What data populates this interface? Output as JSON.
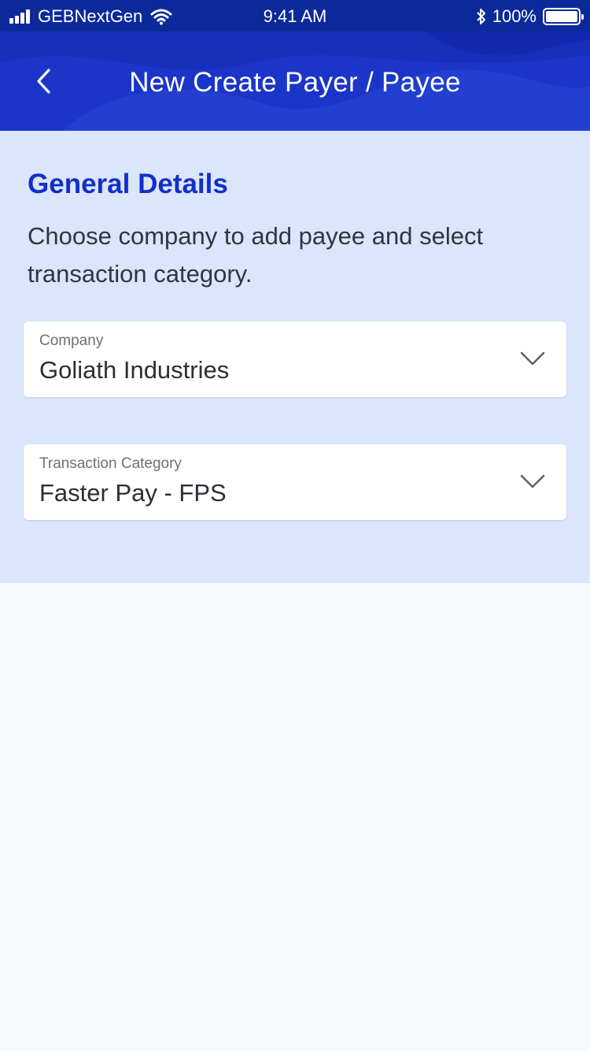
{
  "status_bar": {
    "carrier": "GEBNextGen",
    "time": "9:41 AM",
    "battery_percent": "100%",
    "battery_level": 1.0,
    "icons": [
      "signal-icon",
      "wifi-icon",
      "bluetooth-icon",
      "battery-icon"
    ]
  },
  "header": {
    "title": "New Create Payer / Payee",
    "back_icon": "chevron-left-icon"
  },
  "general_details": {
    "title": "General Details",
    "description": "Choose company to add payee and select transaction category."
  },
  "fields": [
    {
      "label": "Company",
      "value": "Goliath Industries",
      "icon": "chevron-down-icon"
    },
    {
      "label": "Transaction Category",
      "value": "Faster Pay - FPS",
      "icon": "chevron-down-icon"
    }
  ],
  "colors": {
    "header_bg": "#1a35c8",
    "status_bg": "#0b2a9a",
    "panel_bg": "#dbe5fb",
    "accent": "#1230c8",
    "page_bg": "#f6f8fb"
  }
}
